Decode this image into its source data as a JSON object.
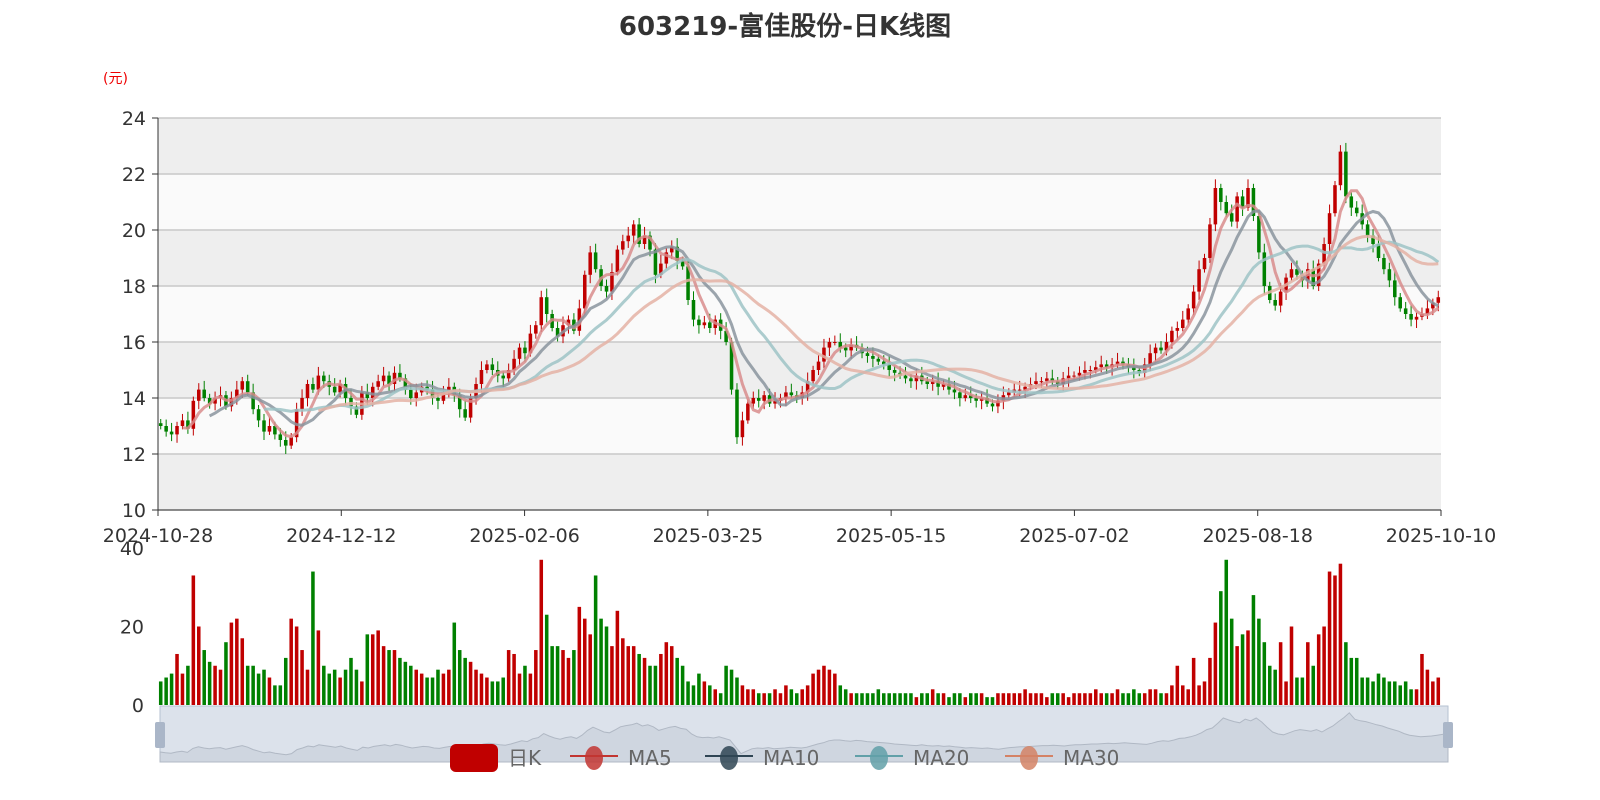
{
  "chart_data": {
    "type": "candlestick",
    "title": "603219-富佳股份-日K线图",
    "ylabel": "(元)",
    "ylim": [
      10,
      24
    ],
    "yticks": [
      "10",
      "12",
      "14",
      "16",
      "18",
      "20",
      "22",
      "24"
    ],
    "volume_ylim": [
      0,
      40
    ],
    "volume_yticks": [
      "0",
      "20",
      "40"
    ],
    "xtick_labels": [
      "2024-10-28",
      "2024-12-12",
      "2025-02-06",
      "2025-03-25",
      "2025-05-15",
      "2025-07-02",
      "2025-08-18",
      "2025-10-10"
    ],
    "legend": [
      "日K",
      "MA5",
      "MA10",
      "MA20",
      "MA30"
    ],
    "legend_position": "bottom",
    "colors": {
      "up": "#c00000",
      "down": "#008000",
      "ma5": "#d88c8c",
      "ma10": "#8a949e",
      "ma20": "#9ec3c6",
      "ma30": "#e4b1a4",
      "grid": "#c8c8c8",
      "band": "#eeeeee"
    },
    "close": [
      13.0,
      12.8,
      12.7,
      13.0,
      13.2,
      12.9,
      13.9,
      14.3,
      14.0,
      13.8,
      14.0,
      14.1,
      13.7,
      14.0,
      14.3,
      14.6,
      14.2,
      13.6,
      13.2,
      12.8,
      13.0,
      12.7,
      12.5,
      12.3,
      12.6,
      13.6,
      14.0,
      14.5,
      14.3,
      14.8,
      14.6,
      14.4,
      14.2,
      14.5,
      14.0,
      13.7,
      13.4,
      14.2,
      14.0,
      14.4,
      14.6,
      14.8,
      14.5,
      14.9,
      14.7,
      14.3,
      14.0,
      14.2,
      14.4,
      14.3,
      14.0,
      13.9,
      14.2,
      14.4,
      14.1,
      13.6,
      13.3,
      14.0,
      14.5,
      15.0,
      15.2,
      15.0,
      14.8,
      14.7,
      15.0,
      15.4,
      15.8,
      15.6,
      16.3,
      16.6,
      17.6,
      17.0,
      16.5,
      16.2,
      16.6,
      16.8,
      16.4,
      17.2,
      18.4,
      19.2,
      18.6,
      18.0,
      17.8,
      18.5,
      19.3,
      19.6,
      19.8,
      20.2,
      19.5,
      19.8,
      19.3,
      18.4,
      18.8,
      19.2,
      19.4,
      18.9,
      18.7,
      17.5,
      16.8,
      16.6,
      16.7,
      16.5,
      16.8,
      16.4,
      16.0,
      14.3,
      12.6,
      13.2,
      13.8,
      14.0,
      13.9,
      14.1,
      13.8,
      13.9,
      14.0,
      14.2,
      14.1,
      14.0,
      14.2,
      14.6,
      15.0,
      15.3,
      15.8,
      16.0,
      16.0,
      15.8,
      15.7,
      15.9,
      15.8,
      15.6,
      15.5,
      15.4,
      15.3,
      15.2,
      15.0,
      14.9,
      14.8,
      14.7,
      14.6,
      14.8,
      14.6,
      14.5,
      14.6,
      14.4,
      14.5,
      14.3,
      14.2,
      14.0,
      14.1,
      14.0,
      13.9,
      14.0,
      13.8,
      13.7,
      13.9,
      14.1,
      14.2,
      14.3,
      14.3,
      14.4,
      14.5,
      14.6,
      14.6,
      14.7,
      14.6,
      14.5,
      14.7,
      14.8,
      14.8,
      14.9,
      15.0,
      15.0,
      15.1,
      15.2,
      15.1,
      15.2,
      15.3,
      15.2,
      15.1,
      15.0,
      14.9,
      15.2,
      15.6,
      15.8,
      15.7,
      16.0,
      16.4,
      16.5,
      16.8,
      17.2,
      17.8,
      18.6,
      19.0,
      20.2,
      21.5,
      21.0,
      20.6,
      20.3,
      21.2,
      20.8,
      21.5,
      20.5,
      19.2,
      18.0,
      17.5,
      17.3,
      17.8,
      18.3,
      18.6,
      18.4,
      18.2,
      18.6,
      18.0,
      18.8,
      19.5,
      20.6,
      21.6,
      22.8,
      21.2,
      20.8,
      20.6,
      20.2,
      19.8,
      19.5,
      19.0,
      18.6,
      18.2,
      17.6,
      17.2,
      17.0,
      16.8,
      16.9,
      17.0,
      17.2,
      17.4,
      17.6
    ],
    "volume": [
      6,
      7,
      8,
      13,
      8,
      10,
      33,
      20,
      14,
      11,
      10,
      9,
      16,
      21,
      22,
      17,
      10,
      10,
      8,
      9,
      7,
      5,
      5,
      12,
      22,
      20,
      14,
      9,
      34,
      19,
      10,
      8,
      9,
      7,
      9,
      12,
      9,
      6,
      18,
      18,
      19,
      15,
      14,
      14,
      12,
      11,
      10,
      9,
      8,
      7,
      7,
      9,
      8,
      9,
      21,
      14,
      12,
      11,
      9,
      8,
      7,
      6,
      6,
      7,
      14,
      13,
      8,
      10,
      8,
      14,
      37,
      23,
      15,
      15,
      14,
      12,
      14,
      25,
      22,
      18,
      33,
      22,
      20,
      15,
      24,
      17,
      15,
      15,
      13,
      12,
      10,
      10,
      13,
      16,
      15,
      12,
      10,
      6,
      5,
      8,
      6,
      5,
      4,
      3,
      10,
      9,
      7,
      5,
      4,
      4,
      3,
      3,
      3,
      4,
      3,
      5,
      4,
      3,
      4,
      5,
      8,
      9,
      10,
      9,
      8,
      5,
      4,
      3,
      3,
      3,
      3,
      3,
      4,
      3,
      3,
      3,
      3,
      3,
      3,
      2,
      3,
      3,
      4,
      3,
      3,
      2,
      3,
      3,
      2,
      3,
      3,
      3,
      2,
      2,
      3,
      3,
      3,
      3,
      3,
      4,
      3,
      3,
      3,
      2,
      3,
      3,
      3,
      2,
      3,
      3,
      3,
      3,
      4,
      3,
      3,
      3,
      4,
      3,
      3,
      4,
      3,
      3,
      4,
      4,
      3,
      3,
      5,
      10,
      5,
      4,
      12,
      5,
      6,
      12,
      21,
      29,
      37,
      22,
      15,
      18,
      19,
      28,
      22,
      16,
      10,
      9,
      16,
      6,
      20,
      7,
      7,
      16,
      10,
      18,
      20,
      34,
      33,
      36,
      16,
      12,
      12,
      7,
      7,
      6,
      8,
      7,
      6,
      6,
      5,
      6,
      4,
      4,
      13,
      9,
      6,
      7
    ]
  }
}
